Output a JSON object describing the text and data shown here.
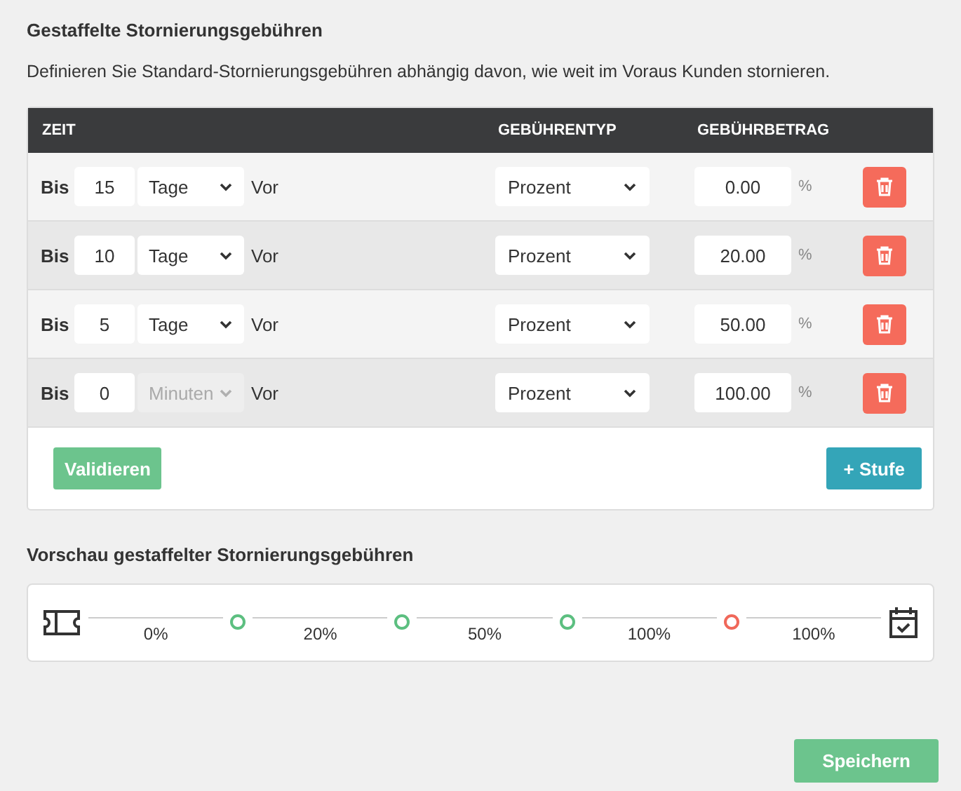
{
  "title": "Gestaffelte Stornierungsgebühren",
  "description": "Definieren Sie Standard-Stornierungsgebühren abhängig davon, wie weit im Voraus Kunden stornieren.",
  "table": {
    "columns": [
      "ZEIT",
      "GEBÜHRENTYP",
      "GEBÜHRBETRAG"
    ],
    "rows": [
      {
        "prefix": "Bis",
        "amount": "15",
        "unit": "Tage",
        "unit_disabled": false,
        "suffix": "Vor",
        "fee_type": "Prozent",
        "fee": "0.00",
        "fee_unit": "%"
      },
      {
        "prefix": "Bis",
        "amount": "10",
        "unit": "Tage",
        "unit_disabled": false,
        "suffix": "Vor",
        "fee_type": "Prozent",
        "fee": "20.00",
        "fee_unit": "%"
      },
      {
        "prefix": "Bis",
        "amount": "5",
        "unit": "Tage",
        "unit_disabled": false,
        "suffix": "Vor",
        "fee_type": "Prozent",
        "fee": "50.00",
        "fee_unit": "%"
      },
      {
        "prefix": "Bis",
        "amount": "0",
        "unit": "Minuten",
        "unit_disabled": true,
        "suffix": "Vor",
        "fee_type": "Prozent",
        "fee": "100.00",
        "fee_unit": "%"
      }
    ]
  },
  "validate_button": "Validieren",
  "add_button": "+ Stufe",
  "preview": {
    "title": "Vorschau gestaffelter Stornierungsgebühren",
    "segments": [
      {
        "label": "0%"
      },
      {
        "label": "20%"
      },
      {
        "label": "50%"
      },
      {
        "label": "100%"
      },
      {
        "label": "100%"
      }
    ],
    "markers": [
      {
        "color": "#5cbf80"
      },
      {
        "color": "#5cbf80"
      },
      {
        "color": "#5cbf80"
      },
      {
        "color": "#f0685a"
      }
    ]
  },
  "save_button": "Speichern"
}
